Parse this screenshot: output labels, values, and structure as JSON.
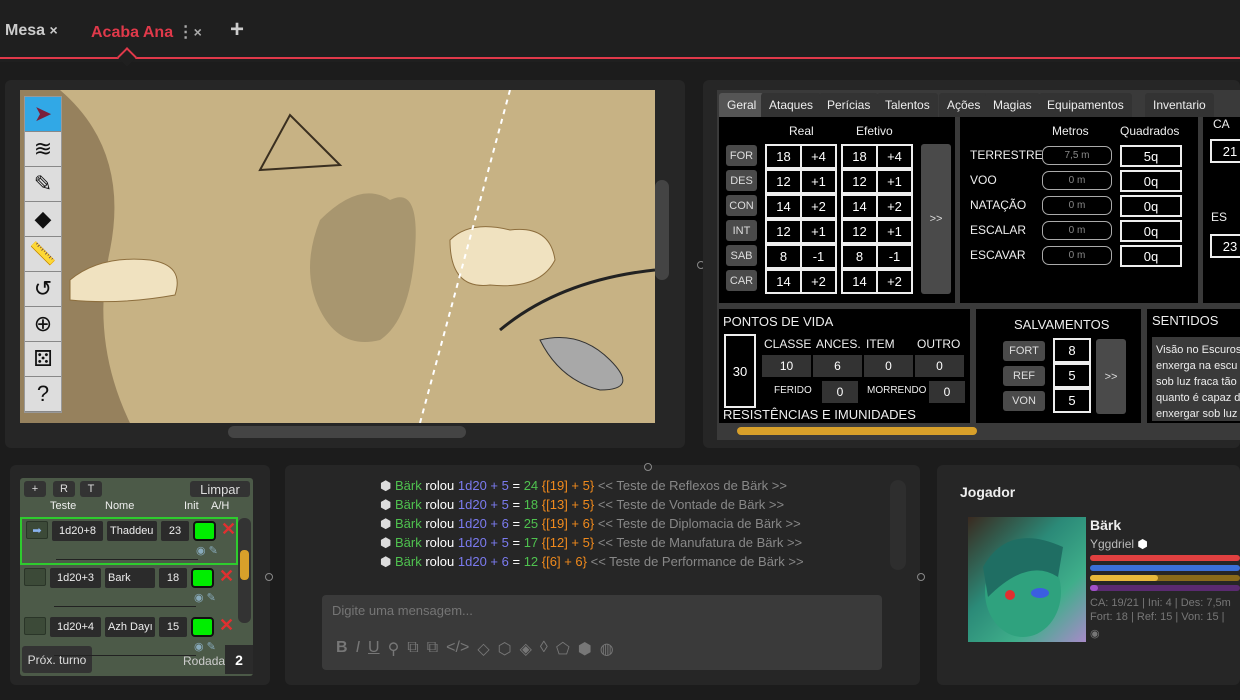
{
  "tabs": [
    {
      "label": "Mesa",
      "close": "×"
    },
    {
      "label": "Acaba Ana",
      "menu": "⋮",
      "close": "×",
      "active": true
    }
  ],
  "add_tab": "+",
  "colors": {
    "accent": "#e0394a",
    "hp": "#e04040",
    "mana": "#3a6fd8",
    "xp": "#d8a72a",
    "hero": "#8a3bb0",
    "active_turn": "#2ecc2e"
  },
  "map_tools": [
    {
      "icon": "cursor-icon",
      "glyph": "➤"
    },
    {
      "icon": "layers-icon",
      "glyph": "≋"
    },
    {
      "icon": "pencil-icon",
      "glyph": "✎"
    },
    {
      "icon": "fog-icon",
      "glyph": "◆"
    },
    {
      "icon": "ruler-icon",
      "glyph": "📏"
    },
    {
      "icon": "history-icon",
      "glyph": "↺"
    },
    {
      "icon": "zoom-icon",
      "glyph": "⊕"
    },
    {
      "icon": "dice-icon",
      "glyph": "⚄"
    },
    {
      "icon": "help-icon",
      "glyph": "?"
    }
  ],
  "sheet": {
    "tabs": [
      "Geral",
      "Ataques",
      "Perícias",
      "Talentos",
      "Ações",
      "Magias",
      "Equipamentos",
      "Inventario"
    ],
    "attr_headers": {
      "real": "Real",
      "efetivo": "Efetivo"
    },
    "attributes": [
      {
        "name": "FOR",
        "real": "18",
        "real_mod": "+4",
        "ef": "18",
        "ef_mod": "+4"
      },
      {
        "name": "DES",
        "real": "12",
        "real_mod": "+1",
        "ef": "12",
        "ef_mod": "+1"
      },
      {
        "name": "CON",
        "real": "14",
        "real_mod": "+2",
        "ef": "14",
        "ef_mod": "+2"
      },
      {
        "name": "INT",
        "real": "12",
        "real_mod": "+1",
        "ef": "12",
        "ef_mod": "+1"
      },
      {
        "name": "SAB",
        "real": "8",
        "real_mod": "-1",
        "ef": "8",
        "ef_mod": "-1"
      },
      {
        "name": "CAR",
        "real": "14",
        "real_mod": "+2",
        "ef": "14",
        "ef_mod": "+2"
      }
    ],
    "expand": ">>",
    "move_headers": {
      "metros": "Metros",
      "quadrados": "Quadrados"
    },
    "movement": [
      {
        "name": "TERRESTRE",
        "m": "7,5 m",
        "q": "5q"
      },
      {
        "name": "VOO",
        "m": "0 m",
        "q": "0q"
      },
      {
        "name": "NATAÇÃO",
        "m": "0 m",
        "q": "0q"
      },
      {
        "name": "ESCALAR",
        "m": "0 m",
        "q": "0q"
      },
      {
        "name": "ESCAVAR",
        "m": "0 m",
        "q": "0q"
      }
    ],
    "ca": {
      "label": "CA",
      "value": "21",
      "label2": "ES",
      "value2": "23"
    },
    "hp": {
      "title": "PONTOS DE VIDA",
      "total": "30",
      "headers": [
        "CLASSE",
        "ANCES.",
        "ITEM",
        "OUTRO"
      ],
      "values": [
        "10",
        "6",
        "0",
        "0"
      ],
      "ferido_label": "FERIDO",
      "ferido": "0",
      "morrendo_label": "MORRENDO",
      "morrendo": "0"
    },
    "resist_title": "RESISTÊNCIAS E IMUNIDADES",
    "saves": {
      "title": "SALVAMENTOS",
      "items": [
        {
          "name": "FORT",
          "value": "8"
        },
        {
          "name": "REF",
          "value": "5"
        },
        {
          "name": "VON",
          "value": "5"
        }
      ]
    },
    "senses": {
      "title": "SENTIDOS",
      "lines": [
        "Visão no Escuros",
        "enxerga na escu",
        "sob luz fraca tão",
        "quanto é capaz d",
        "enxergar sob luz"
      ]
    }
  },
  "initiative": {
    "add": "+",
    "r": "R",
    "t": "T",
    "clear": "Limpar",
    "headers": {
      "teste": "Teste",
      "nome": "Nome",
      "init": "Init",
      "ah": "A/H"
    },
    "rows": [
      {
        "test": "1d20+8",
        "name": "Thaddeu",
        "init": "23",
        "current": true
      },
      {
        "test": "1d20+3",
        "name": "Bark",
        "init": "18"
      },
      {
        "test": "1d20+4",
        "name": "Azh Dayı",
        "init": "15"
      }
    ],
    "next": "Próx. turno",
    "round_label": "Rodada",
    "round": "2"
  },
  "chat": {
    "messages": [
      {
        "who": "Bärk",
        "verb": "rolou",
        "dice": "1d20 + 5",
        "eq": "=",
        "total": "24",
        "detail": "{[19] + 5}",
        "label": "<< Teste de Reflexos de Bärk >>"
      },
      {
        "who": "Bärk",
        "verb": "rolou",
        "dice": "1d20 + 5",
        "eq": "=",
        "total": "18",
        "detail": "{[13] + 5}",
        "label": "<< Teste de Vontade de Bärk >>"
      },
      {
        "who": "Bärk",
        "verb": "rolou",
        "dice": "1d20 + 6",
        "eq": "=",
        "total": "25",
        "detail": "{[19] + 6}",
        "label": "<< Teste de Diplomacia de Bärk >>"
      },
      {
        "who": "Bärk",
        "verb": "rolou",
        "dice": "1d20 + 5",
        "eq": "=",
        "total": "17",
        "detail": "{[12] + 5}",
        "label": "<< Teste de Manufatura de Bärk >>"
      },
      {
        "who": "Bärk",
        "verb": "rolou",
        "dice": "1d20 + 6",
        "eq": "=",
        "total": "12",
        "detail": "{[6] + 6}",
        "label": "<< Teste de Performance de Bärk >>"
      }
    ],
    "placeholder": "Digite uma mensagem...",
    "toolbar": [
      {
        "icon": "bold-icon",
        "glyph": "B"
      },
      {
        "icon": "italic-icon",
        "glyph": "I"
      },
      {
        "icon": "underline-icon",
        "glyph": "U"
      },
      {
        "icon": "attach-icon",
        "glyph": "⚲"
      },
      {
        "icon": "macro-add-icon",
        "glyph": "⧉"
      },
      {
        "icon": "macro-remove-icon",
        "glyph": "⧉"
      },
      {
        "icon": "code-icon",
        "glyph": "</>"
      },
      {
        "icon": "d4-icon",
        "glyph": "◇"
      },
      {
        "icon": "d6-icon",
        "glyph": "⬡"
      },
      {
        "icon": "d8-icon",
        "glyph": "◈"
      },
      {
        "icon": "d10-icon",
        "glyph": "◊"
      },
      {
        "icon": "d12-icon",
        "glyph": "⬠"
      },
      {
        "icon": "d20-icon",
        "glyph": "⬢"
      },
      {
        "icon": "d100-icon",
        "glyph": "◍"
      }
    ]
  },
  "player": {
    "title": "Jogador",
    "name": "Bärk",
    "user": "Yggdriel",
    "bars": {
      "hp": 1.0,
      "mana": 1.0,
      "xp": 0.45,
      "hero": 0.05
    },
    "stats1": "CA: 19/21 | Ini: 4 | Des: 7,5m",
    "stats2": "Fort: 18 | Ref: 15 | Von: 15 |"
  }
}
